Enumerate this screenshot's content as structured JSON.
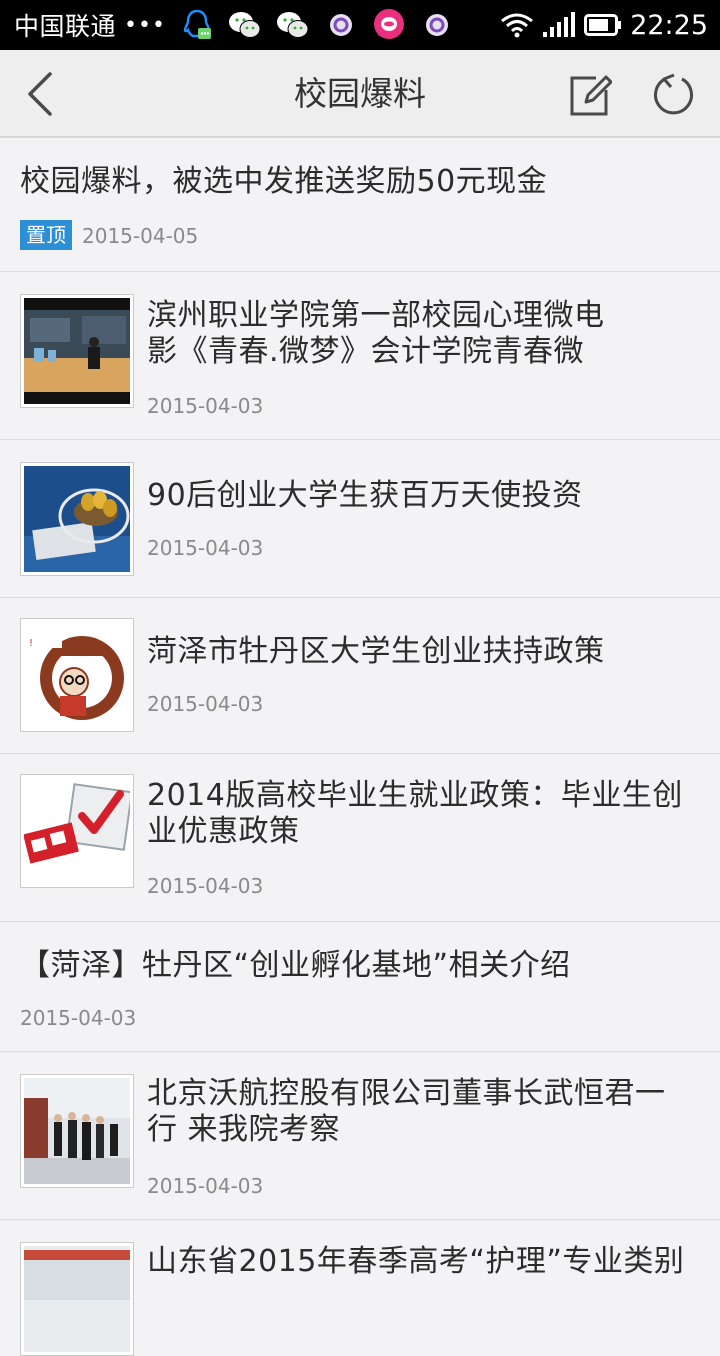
{
  "status_bar": {
    "carrier": "中国联通",
    "dots": "•••",
    "time": "22:25",
    "notification_icons": [
      "qq-icon",
      "wechat-icon",
      "wechat-icon",
      "purple-circle-icon",
      "pink-chat-icon",
      "purple-circle-icon"
    ],
    "system_icons": [
      "wifi-icon",
      "signal-icon",
      "battery-icon"
    ]
  },
  "header": {
    "title": "校园爆料",
    "back_icon": "chevron-left-icon",
    "edit_icon": "edit-icon",
    "refresh_icon": "refresh-icon"
  },
  "colors": {
    "accent_blue": "#2d8fd5",
    "background": "#f3f2f4",
    "header_bg": "#eeeeef",
    "date_gray": "#8a8a8a"
  },
  "items": [
    {
      "title_lines": [
        "校园爆料，被选中发推送奖励50元现金"
      ],
      "badge": "置顶",
      "date": "2015-04-05"
    },
    {
      "title_lines": [
        "滨州职业学院第一部校园心理微电",
        "影《青春.微梦》会计学院青春微"
      ],
      "date": "2015-04-03",
      "thumb": "classroom-photo"
    },
    {
      "title_lines": [
        "90后创业大学生获百万天使投资"
      ],
      "date": "2015-04-03",
      "thumb": "golden-eggs-photo"
    },
    {
      "title_lines": [
        "菏泽市牡丹区大学生创业扶持政策"
      ],
      "date": "2015-04-03",
      "thumb": "startup-cartoon"
    },
    {
      "title_lines": [
        "2014版高校毕业生就业政策：毕业生创",
        "业优惠政策"
      ],
      "date": "2015-04-03",
      "thumb": "checkmark-graphic"
    },
    {
      "title_lines": [
        "【菏泽】牡丹区“创业孵化基地”相关介绍"
      ],
      "date": "2015-04-03"
    },
    {
      "title_lines": [
        "北京沃航控股有限公司董事长武恒君一",
        "行 来我院考察"
      ],
      "date": "2015-04-03",
      "thumb": "visitors-photo"
    },
    {
      "title_lines": [
        "山东省2015年春季高考“护理”专业类别"
      ],
      "thumb": "building-photo"
    }
  ]
}
